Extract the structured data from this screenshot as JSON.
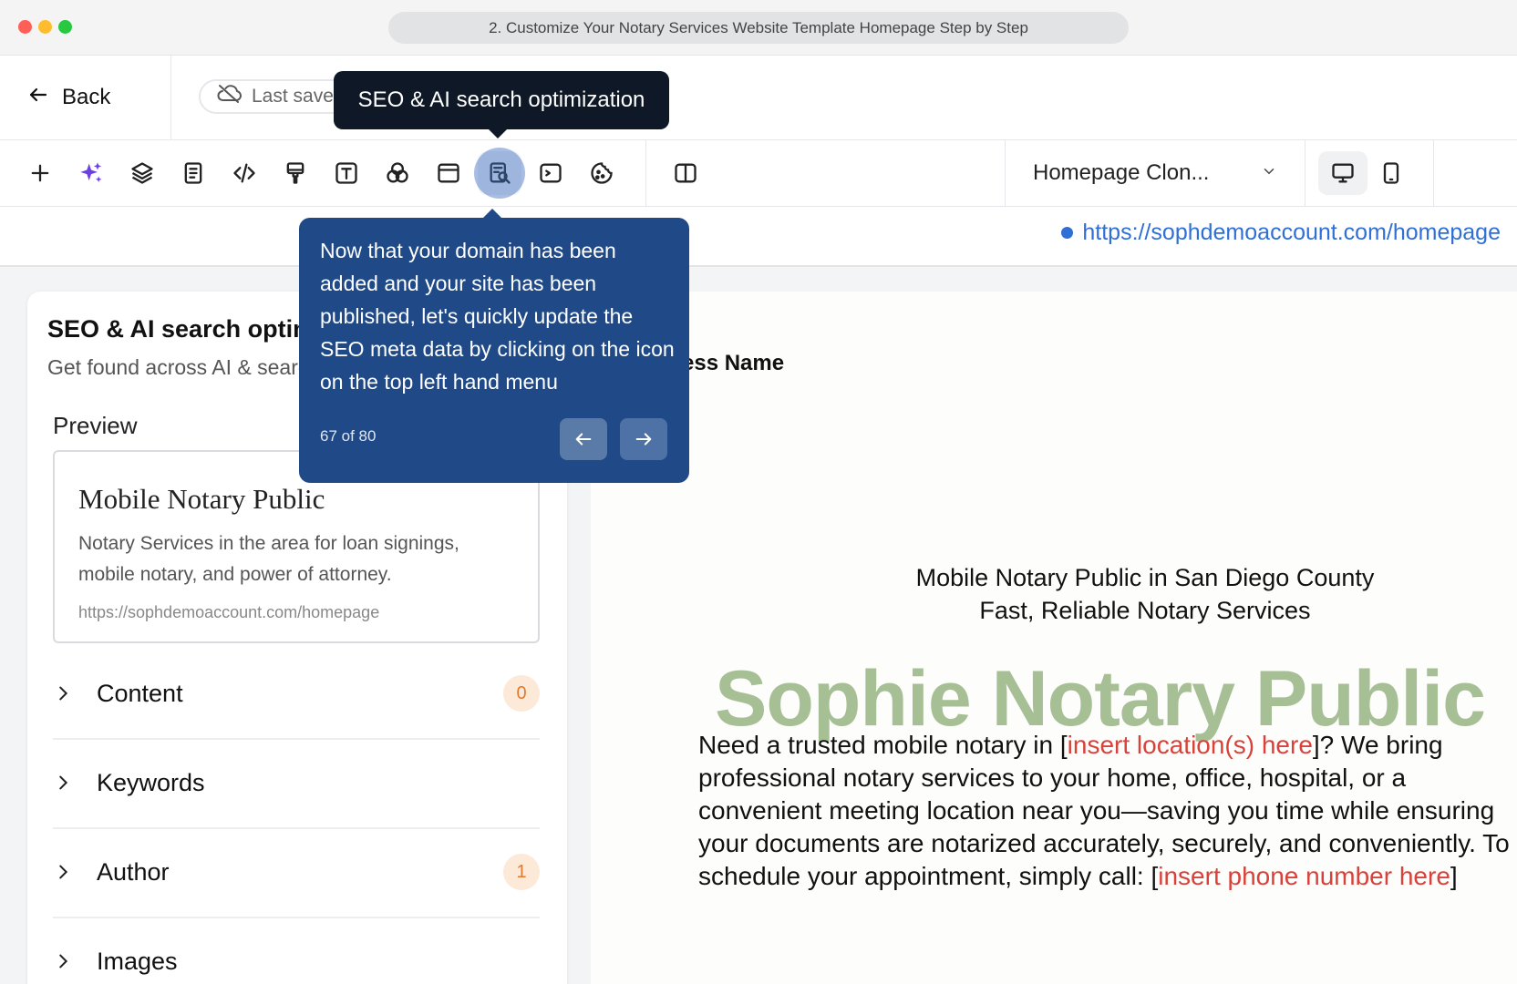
{
  "window": {
    "title": "2. Customize Your Notary Services Website Template Homepage Step by Step"
  },
  "header": {
    "back_label": "Back",
    "last_saved": "Last saved"
  },
  "toolbar": {
    "page_select_value": "Homepage Clon...",
    "icons": [
      "plus-icon",
      "ai-sparkle-icon",
      "layers-icon",
      "page-icon",
      "code-icon",
      "brush-icon",
      "text-icon",
      "colors-icon",
      "layout-icon",
      "seo-search-icon",
      "terminal-icon",
      "cookie-icon",
      "split-view-icon"
    ]
  },
  "url_bar": {
    "url": "https://sophdemoaccount.com/homepage"
  },
  "tooltip": {
    "label": "SEO & AI search optimization"
  },
  "guide": {
    "text": "Now that your domain has been added and your site has been published, let's quickly update the SEO meta data by clicking on the icon on the top left hand menu",
    "counter": "67 of 80"
  },
  "panel": {
    "title": "SEO & AI search optimization",
    "subtitle": "Get found across AI & search engines",
    "preview_label": "Preview",
    "preview": {
      "title": "Mobile Notary Public",
      "description": "Notary Services in the area for loan signings, mobile notary, and power of attorney.",
      "url": "https://sophdemoaccount.com/homepage"
    },
    "sections": [
      {
        "label": "Content",
        "badge": "0"
      },
      {
        "label": "Keywords",
        "badge": ""
      },
      {
        "label": "Author",
        "badge": "1"
      },
      {
        "label": "Images",
        "badge": ""
      }
    ]
  },
  "canvas": {
    "business_name": "ess Name",
    "heading_line1": "Mobile Notary Public in San Diego County",
    "heading_line2": "Fast, Reliable Notary Services",
    "big_title": "Sophie Notary Public",
    "para_1": "Need a trusted mobile notary in [",
    "para_red_1": "insert location(s) here",
    "para_2": "]? We bring professional notary services to your home, office, hospital, or a convenient meeting location near you—saving you time while ensuring your documents are notarized accurately, securely, and conveniently. To schedule your appointment, simply call: [",
    "para_red_2": "insert phone number here",
    "para_3": "]"
  },
  "colors": {
    "accent_blue": "#2f6fd6",
    "guide_bg": "#1f4a87",
    "title_green": "#a7bf95",
    "placeholder_red": "#d9423a"
  }
}
